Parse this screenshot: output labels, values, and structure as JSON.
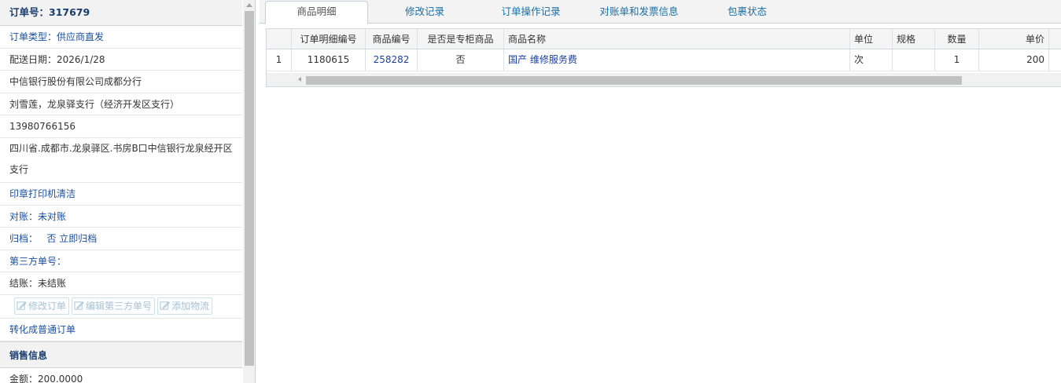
{
  "order": {
    "header": "订单号：317679",
    "type": "订单类型：供应商直发",
    "delivery_date": "配送日期：2026/1/28",
    "company": "中信银行股份有限公司成都分行",
    "contact": "刘雪莲，龙泉驿支行（经济开发区支行）",
    "phone": "13980766156",
    "address": "四川省.成都市.龙泉驿区.书房B口中信银行龙泉经开区支行",
    "product_summary": "印章打印机清洁",
    "reconcile": "对账：未对账",
    "archive": "归档：   否 立即归档",
    "third_party_no": "第三方单号：",
    "settlement": "结账：未结账",
    "buttons": {
      "edit_order": "修改订单",
      "edit_third_party": "编辑第三方单号",
      "add_logistics": "添加物流"
    },
    "convert_link": "转化成普通订单"
  },
  "sales": {
    "header": "销售信息",
    "amount": "金额：200.0000"
  },
  "tabs": [
    {
      "label": "商品明细",
      "active": true
    },
    {
      "label": "修改记录",
      "active": false
    },
    {
      "label": "订单操作记录",
      "active": false
    },
    {
      "label": "对账单和发票信息",
      "active": false
    },
    {
      "label": "包裹状态",
      "active": false
    }
  ],
  "grid": {
    "columns": [
      "",
      "订单明细编号",
      "商品编号",
      "是否是专柜商品",
      "商品名称",
      "单位",
      "规格",
      "数量",
      "单价"
    ],
    "rows": [
      [
        "1",
        "1180615",
        "258282",
        "否",
        "国产 维修服务费",
        "次",
        "",
        "1",
        "200"
      ]
    ]
  },
  "colors": {
    "link_blue": "#1a4fa3",
    "tab_blue": "#1a6fa8",
    "header_blue": "#1a3d6e"
  }
}
